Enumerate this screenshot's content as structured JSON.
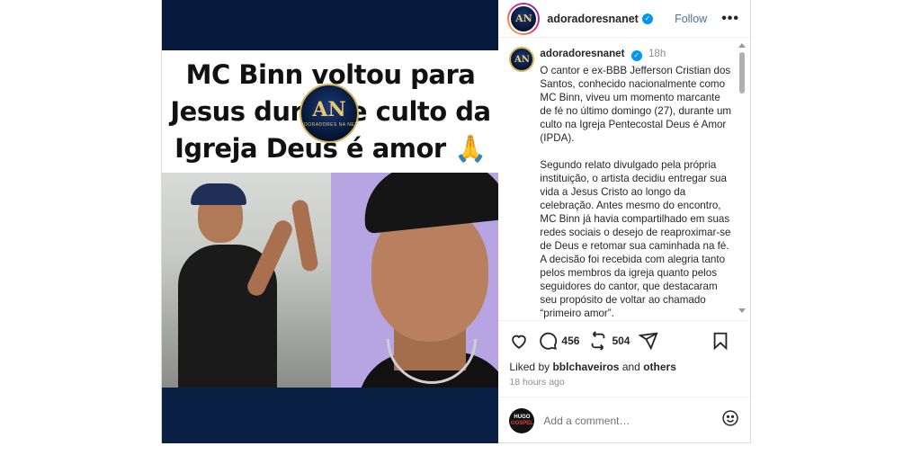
{
  "post": {
    "headline": [
      "MC Binn voltou para",
      "Jesus durante culto da",
      "Igreja Deus é amor 🙏"
    ],
    "logo_letters": "AN",
    "logo_caption": "ADORADORES NA NET"
  },
  "header": {
    "username": "adoradoresnanet",
    "follow_label": "Follow",
    "more_label": "•••"
  },
  "caption": {
    "username": "adoradoresnanet",
    "time": "18h",
    "paragraphs": [
      "O cantor e ex-BBB Jefferson Cristian dos Santos, conhecido nacionalmente como MC Binn, viveu um momento marcante de fé no último domingo (27), durante um culto na Igreja Pentecostal Deus é Amor (IPDA).",
      "Segundo relato divulgado pela própria instituição, o artista decidiu entregar sua vida a Jesus Cristo ao longo da celebração. Antes mesmo do encontro, MC Binn já havia compartilhado em suas redes sociais o desejo de reaproximar-se de Deus e retomar sua caminhada na fé. A decisão foi recebida com alegria tanto pelos membros da igreja quanto pelos seguidores do cantor, que destacaram seu propósito de voltar ao chamado “primeiro amor”."
    ]
  },
  "actions": {
    "comments_count": "456",
    "reposts_count": "504"
  },
  "likes": {
    "prefix": "Liked by ",
    "user": "bblchaveiros",
    "middle": " and ",
    "others": "others"
  },
  "timestamp": "18 hours ago",
  "comment": {
    "placeholder": "Add a comment…",
    "commenter_avatar_text_1": "HUGO",
    "commenter_avatar_text_2": "GOSPEL"
  },
  "colors": {
    "accent": "#0095f6",
    "badge_gold": "#d4b45a",
    "media_navy": "#0a1f44"
  }
}
